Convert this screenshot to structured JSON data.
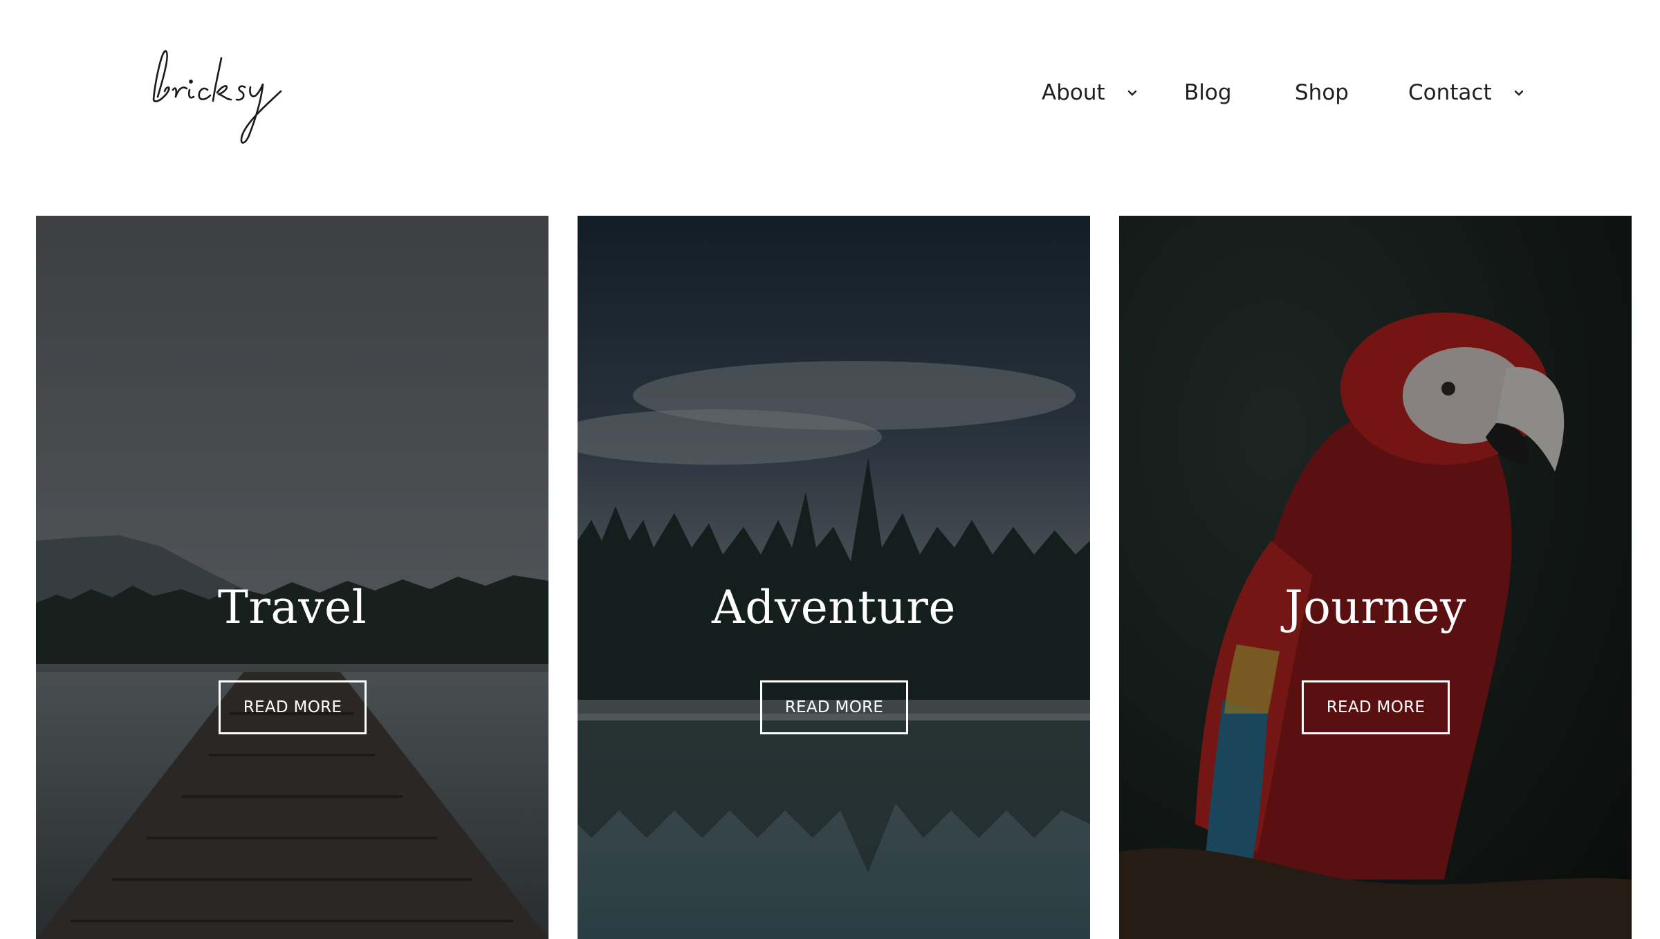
{
  "logo": {
    "text": "bricksy",
    "icon": "handwritten-logo"
  },
  "nav": {
    "items": [
      {
        "label": "About",
        "has_dropdown": true,
        "icon": "chevron-down-icon"
      },
      {
        "label": "Blog",
        "has_dropdown": false
      },
      {
        "label": "Shop",
        "has_dropdown": false
      },
      {
        "label": "Contact",
        "has_dropdown": true,
        "icon": "chevron-down-icon"
      }
    ]
  },
  "cards": [
    {
      "title": "Travel",
      "button_label": "READ MORE",
      "image": "lake-dock-photo"
    },
    {
      "title": "Adventure",
      "button_label": "READ MORE",
      "image": "misty-forest-lake-photo"
    },
    {
      "title": "Journey",
      "button_label": "READ MORE",
      "image": "macaw-parrot-photo"
    }
  ],
  "colors": {
    "text_dark": "#1f1f1f",
    "overlay": "#000000",
    "button_border": "#ffffff"
  }
}
